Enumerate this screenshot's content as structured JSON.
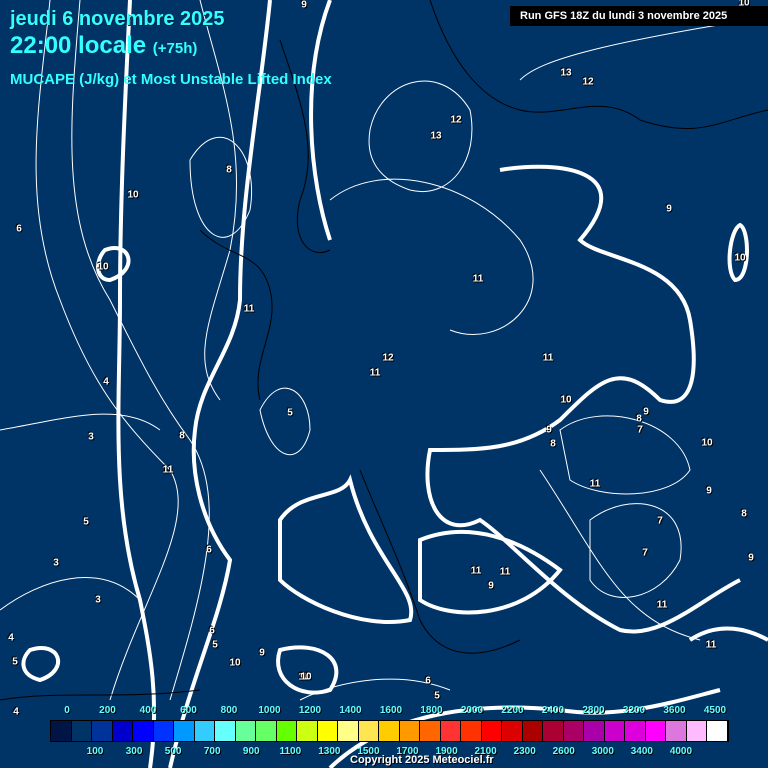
{
  "header": {
    "date": "jeudi 6 novembre 2025",
    "time": "22:00 locale",
    "lead": "(+75h)",
    "parameter": "MUCAPE (J/kg) et Most Unstable Lifted Index",
    "run": "Run GFS 18Z du lundi 3 novembre 2025"
  },
  "legend": {
    "colors": [
      "#001445",
      "#003366",
      "#003399",
      "#0000cc",
      "#0000ff",
      "#0033ff",
      "#0099ff",
      "#33ccff",
      "#66ffff",
      "#66ff99",
      "#66ff66",
      "#66ff00",
      "#ccff11",
      "#ffff00",
      "#ffff88",
      "#ffe650",
      "#ffcc00",
      "#ff9900",
      "#ff6600",
      "#ff3333",
      "#ff3300",
      "#ff0000",
      "#dd0000",
      "#aa0000",
      "#aa0033",
      "#aa0066",
      "#aa00aa",
      "#cc00cc",
      "#dd00dd",
      "#ff00ff",
      "#dd77dd",
      "#ffbbff",
      "#ffffff"
    ],
    "top_labels": [
      "0",
      "200",
      "400",
      "600",
      "800",
      "1000",
      "1200",
      "1400",
      "1600",
      "1800",
      "2000",
      "2200",
      "2400",
      "2800",
      "3200",
      "3600",
      "4500"
    ],
    "bottom_labels": [
      "100",
      "300",
      "500",
      "700",
      "900",
      "1100",
      "1300",
      "1500",
      "1700",
      "1900",
      "2100",
      "2300",
      "2600",
      "3000",
      "3400",
      "4000"
    ]
  },
  "contour_labels": [
    "9",
    "10",
    "13",
    "12",
    "13",
    "12",
    "8",
    "10",
    "6",
    "10",
    "9",
    "10",
    "11",
    "11",
    "11",
    "12",
    "11",
    "5",
    "4",
    "8",
    "3",
    "11",
    "10",
    "9",
    "8",
    "7",
    "9",
    "8",
    "5",
    "3",
    "6",
    "3",
    "11",
    "10",
    "11",
    "11",
    "9",
    "9",
    "8",
    "7",
    "7",
    "11",
    "9",
    "11",
    "10",
    "6",
    "5",
    "10",
    "9",
    "10",
    "6",
    "5",
    "4",
    "4",
    "5"
  ],
  "copyright": "Copyright 2025 Meteociel.fr"
}
